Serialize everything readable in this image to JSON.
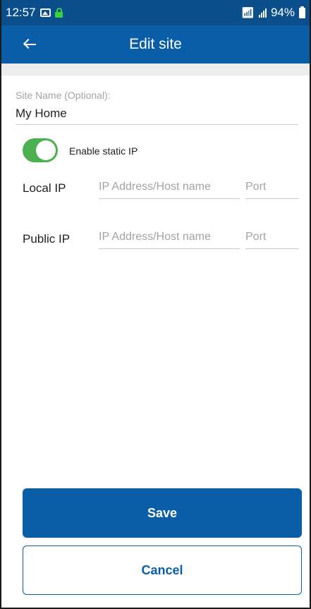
{
  "status_bar": {
    "time": "12:57",
    "battery": "94%",
    "icons": [
      "image-icon",
      "lock-icon",
      "wifi-icon",
      "signal-icon",
      "battery-icon"
    ]
  },
  "app_bar": {
    "title": "Edit site",
    "back_icon": "back-arrow-icon"
  },
  "form": {
    "site_name_label": "Site Name (Optional):",
    "site_name_value": "My Home",
    "static_ip_label": "Enable static IP",
    "static_ip_enabled": true,
    "local_ip": {
      "label": "Local IP",
      "address_placeholder": "IP Address/Host name",
      "port_placeholder": "Port"
    },
    "public_ip": {
      "label": "Public IP",
      "address_placeholder": "IP Address/Host name",
      "port_placeholder": "Port"
    }
  },
  "actions": {
    "save_label": "Save",
    "cancel_label": "Cancel"
  },
  "colors": {
    "status_bar": "#0a4f8c",
    "app_bar": "#0a5ea8",
    "toggle_on": "#4caf50",
    "lock": "#39d13f"
  }
}
